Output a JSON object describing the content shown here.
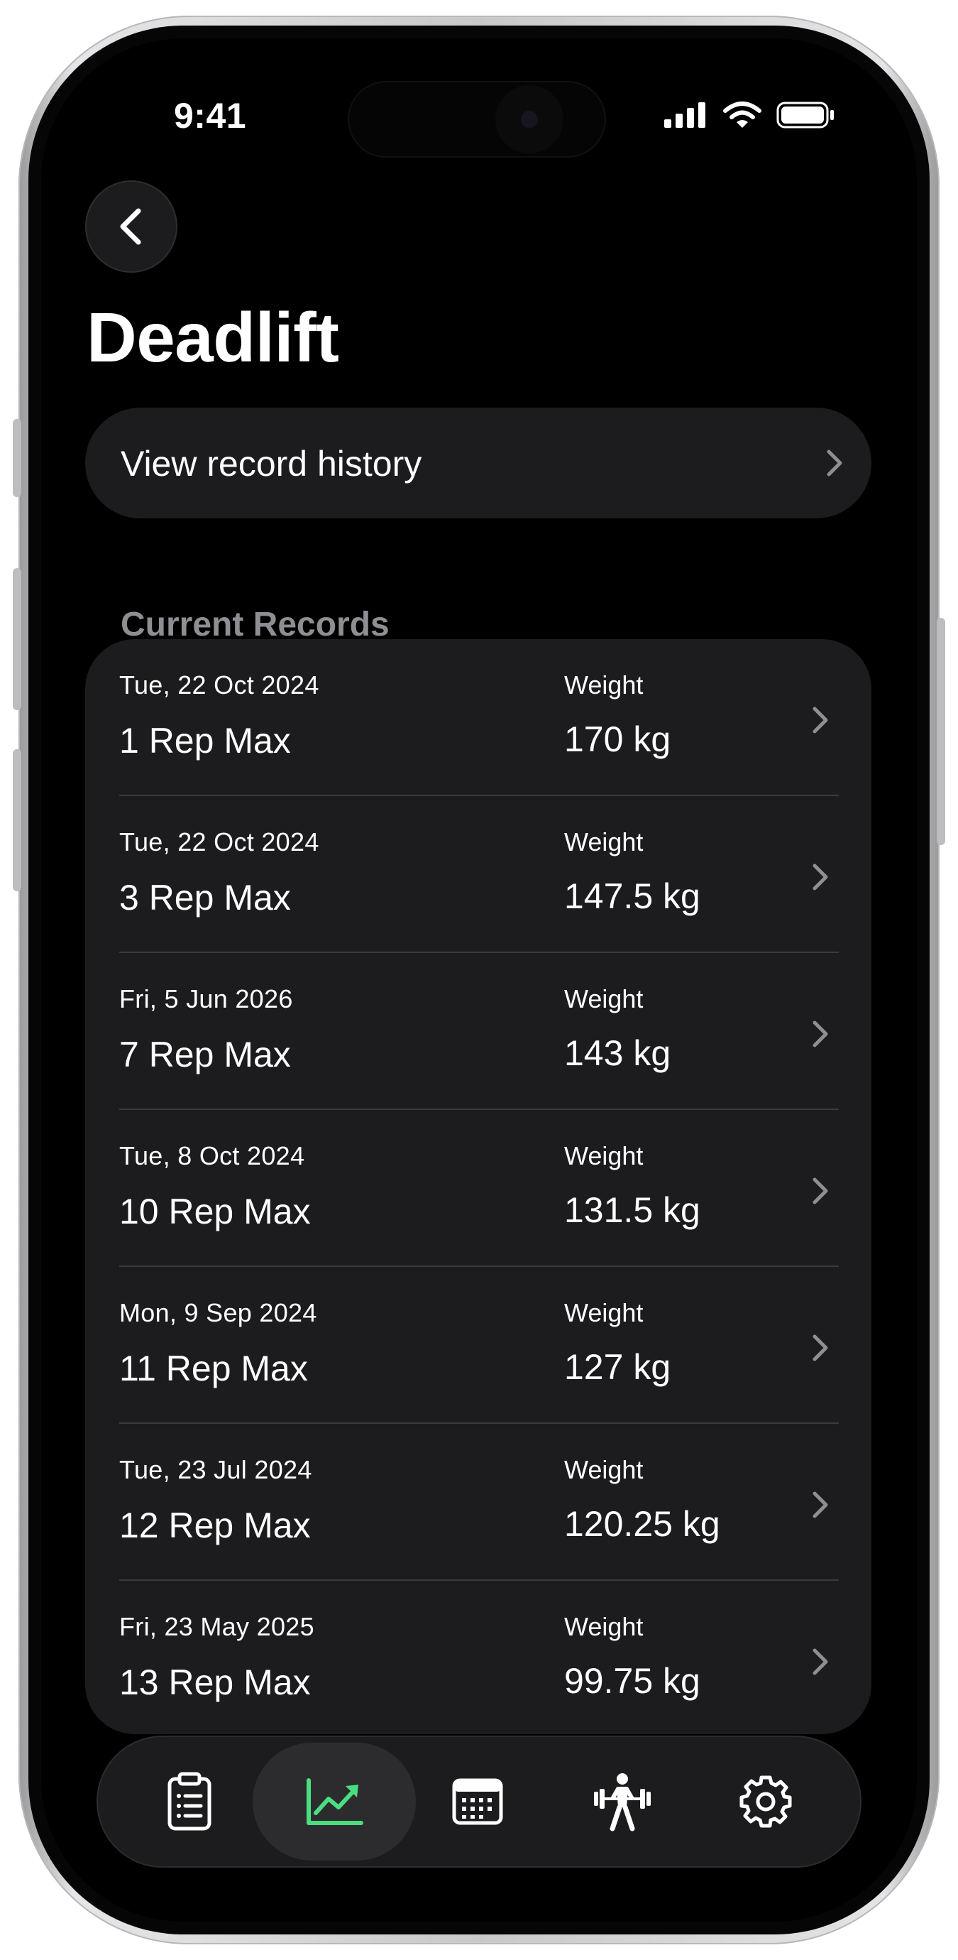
{
  "status_bar": {
    "time": "9:41"
  },
  "header": {
    "back_icon": "chevron-left-icon",
    "title": "Deadlift"
  },
  "history_button": {
    "label": "View record history",
    "icon": "chevron-right-icon"
  },
  "records_section": {
    "title": "Current Records",
    "weight_label": "Weight",
    "records": [
      {
        "date": "Tue, 22 Oct 2024",
        "name": "1 Rep Max",
        "weight": "170 kg"
      },
      {
        "date": "Tue, 22 Oct 2024",
        "name": "3 Rep Max",
        "weight": "147.5 kg"
      },
      {
        "date": "Fri, 5 Jun 2026",
        "name": "7 Rep Max",
        "weight": "143 kg"
      },
      {
        "date": "Tue, 8 Oct 2024",
        "name": "10 Rep Max",
        "weight": "131.5 kg"
      },
      {
        "date": "Mon, 9 Sep 2024",
        "name": "11 Rep Max",
        "weight": "127 kg"
      },
      {
        "date": "Tue, 23 Jul 2024",
        "name": "12 Rep Max",
        "weight": "120.25 kg"
      },
      {
        "date": "Fri, 23 May 2025",
        "name": "13 Rep Max",
        "weight": "99.75 kg"
      }
    ]
  },
  "tab_bar": {
    "tabs": [
      {
        "name": "log",
        "icon": "clipboard-list-icon",
        "active": false
      },
      {
        "name": "progress",
        "icon": "chart-trend-up-icon",
        "active": true
      },
      {
        "name": "calendar",
        "icon": "calendar-icon",
        "active": false
      },
      {
        "name": "exercises",
        "icon": "weightlifter-icon",
        "active": false
      },
      {
        "name": "settings",
        "icon": "gear-icon",
        "active": false
      }
    ]
  },
  "colors": {
    "background": "#000000",
    "card": "#1c1c1e",
    "divider": "#3a3a3c",
    "secondary_text": "#8e8e93",
    "chevron": "#8e8e93",
    "accent": "#4ade80"
  }
}
